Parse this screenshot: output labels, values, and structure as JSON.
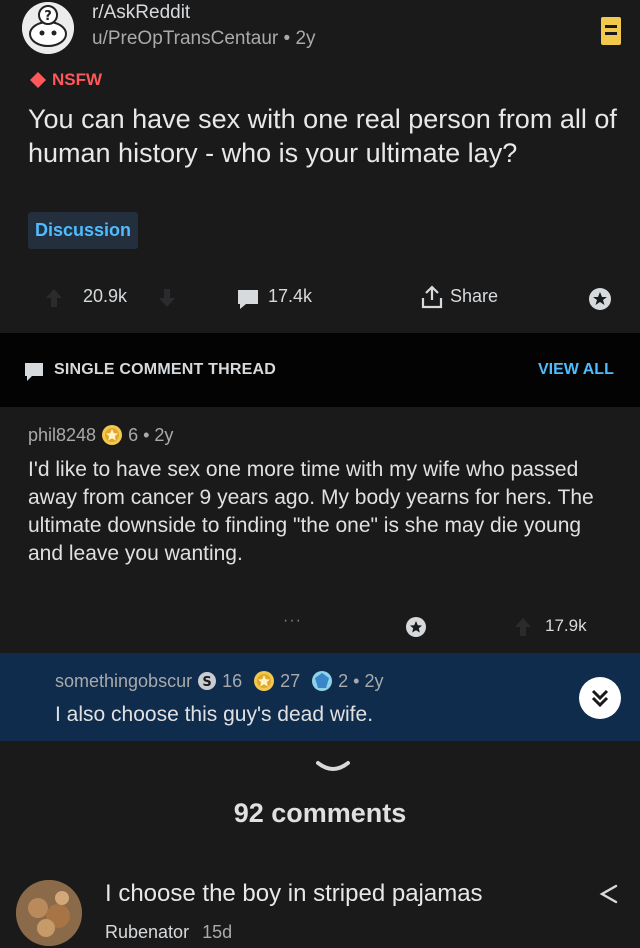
{
  "post": {
    "subreddit": "r/AskReddit",
    "author": "u/PreOpTransCentaur",
    "time": "2y",
    "nsfw_label": "NSFW",
    "title": "You can have sex with one real person from all of human history - who is your ultimate lay?",
    "flair": "Discussion",
    "votes": "20.9k",
    "comments": "17.4k",
    "share_label": "Share",
    "meta_separator": "•"
  },
  "thread": {
    "label": "SINGLE COMMENT THREAD",
    "view_all": "VIEW ALL"
  },
  "comment": {
    "author": "phil8248",
    "award_count": "6",
    "time": "2y",
    "body": "I'd like to have sex one more time with my wife who passed away from cancer 9 years ago. My body yearns for hers. The ultimate downside to finding \"the one\" is she may die young and leave you wanting.",
    "more": "···",
    "votes": "17.9k"
  },
  "reply": {
    "author": "somethingobscur",
    "silver_count": "16",
    "gold_count": "27",
    "other_count": "2",
    "time": "2y",
    "body": "I also choose this guy's dead wife."
  },
  "more_comments": "92 comments",
  "preview": {
    "text": "I choose the boy in striped pajamas",
    "user": "Rubenator",
    "time": "15d"
  },
  "colors": {
    "background": "#1a1a1b",
    "accent_blue": "#4fbcff",
    "nsfw_red": "#ff585b",
    "reply_highlight": "#0f2c4d",
    "award_gold": "#f2c94c"
  }
}
